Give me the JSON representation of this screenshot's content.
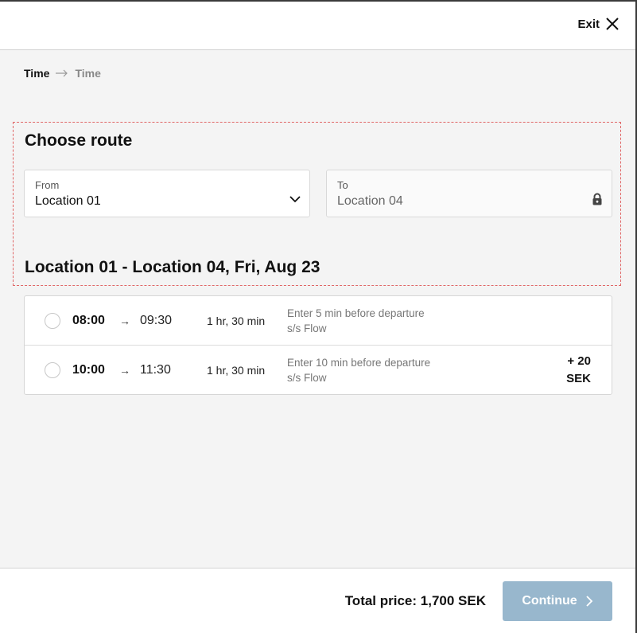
{
  "header": {
    "exit_label": "Exit",
    "exit_icon": "close-icon"
  },
  "breadcrumb": {
    "items": [
      "Time",
      "Time"
    ],
    "separator_icon": "arrow-right-icon"
  },
  "route": {
    "title": "Choose route",
    "from": {
      "label": "From",
      "value": "Location 01",
      "icon": "chevron-down-icon"
    },
    "to": {
      "label": "To",
      "value": "Location 04",
      "icon": "lock-icon"
    },
    "summary": "Location 01 - Location 04, Fri, Aug 23"
  },
  "departures": [
    {
      "departure": "08:00",
      "arrival": "09:30",
      "duration": "1 hr, 30 min",
      "note_line1": "Enter 5 min before departure",
      "note_line2": "s/s Flow",
      "surcharge_amount": "",
      "surcharge_currency": "",
      "selected": false
    },
    {
      "departure": "10:00",
      "arrival": "11:30",
      "duration": "1 hr, 30 min",
      "note_line1": "Enter 10 min before departure",
      "note_line2": "s/s Flow",
      "surcharge_amount": "+ 20",
      "surcharge_currency": "SEK",
      "selected": false
    }
  ],
  "footer": {
    "total_price": "Total price: 1,700 SEK",
    "continue_label": "Continue",
    "continue_enabled": false
  },
  "colors": {
    "accent_disabled": "#98b7cd",
    "highlight_dashed": "#e06666"
  }
}
